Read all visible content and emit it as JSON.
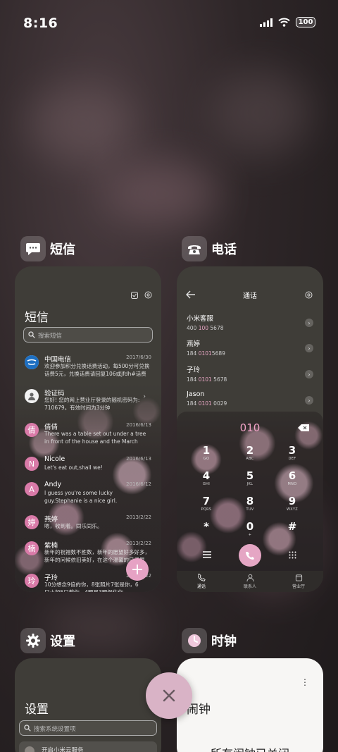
{
  "status": {
    "time": "8:16",
    "battery": "100"
  },
  "apps": {
    "sms": {
      "title": "短信",
      "inner_title": "短信",
      "search_placeholder": "搜索短信",
      "messages": [
        {
          "avatar": "",
          "name": "中国电信",
          "date": "2017/6/30",
          "preview": "欢迎参加积分兑换话费活动，每500分可兑换话费5元，兑换话费请回复106或jfdh#话费"
        },
        {
          "avatar": "",
          "name": "验证码",
          "date": "",
          "preview": "您好! 您的网上营业厅登录的随机密码为: 710679。有效时间为3分钟"
        },
        {
          "avatar": "倩",
          "name": "倩倩",
          "date": "2016/6/13",
          "preview": "There was a table set out under a tree in front of the house and the March Hare an..."
        },
        {
          "avatar": "N",
          "name": "Nicole",
          "date": "2016/6/13",
          "preview": "Let's eat out,shall we!"
        },
        {
          "avatar": "A",
          "name": "Andy",
          "date": "2016/6/12",
          "preview": "I guess you're some lucky guy.Stephanie is a nice girl."
        },
        {
          "avatar": "婷",
          "name": "燕婷",
          "date": "2013/2/22",
          "preview": "嗯，收到着。同乐同乐。"
        },
        {
          "avatar": "楠",
          "name": "紫楠",
          "date": "2013/2/22",
          "preview": "新年的祝福数不胜数，新年的愿望好多好多，新年的问候依旧美好，在这个温馨的日子里"
        },
        {
          "avatar": "玲",
          "name": "子玲",
          "date": "2013/2/22",
          "preview": "10分想念9倍的你，8张照片7张是你，6只小船5只载你，4颗星3颗保佑你"
        }
      ]
    },
    "phone": {
      "title": "电话",
      "inner_title": "通话",
      "contacts": [
        {
          "name": "小米客服",
          "num_pre": "400 ",
          "num_hl": "100",
          "num_post": " 5678"
        },
        {
          "name": "燕婷",
          "num_pre": "184 ",
          "num_hl": "0101",
          "num_post": "5689"
        },
        {
          "name": "子玲",
          "num_pre": "184 ",
          "num_hl": "0101",
          "num_post": " 5678"
        },
        {
          "name": "Jason",
          "num_pre": "184 ",
          "num_hl": "0101",
          "num_post": " 0029"
        }
      ],
      "dial_input": "010",
      "keys": [
        {
          "d": "1",
          "l": "GO"
        },
        {
          "d": "2",
          "l": "ABC"
        },
        {
          "d": "3",
          "l": "DEF"
        },
        {
          "d": "4",
          "l": "GHI"
        },
        {
          "d": "5",
          "l": "JKL"
        },
        {
          "d": "6",
          "l": "MNO"
        },
        {
          "d": "7",
          "l": "PQRS"
        },
        {
          "d": "8",
          "l": "TUV"
        },
        {
          "d": "9",
          "l": "WXYZ"
        },
        {
          "d": "*",
          "l": ""
        },
        {
          "d": "0",
          "l": "+"
        },
        {
          "d": "#",
          "l": ""
        }
      ],
      "tabs": [
        "通话",
        "联系人",
        "营业厅"
      ]
    },
    "settings": {
      "title": "设置",
      "inner_title": "设置",
      "search_placeholder": "搜索系统设置项",
      "first_item": "开启小米云服务"
    },
    "clock": {
      "title": "时钟",
      "inner_title": "闹钟",
      "empty_text": "所有闹钟已关闭"
    }
  },
  "colors": {
    "accent": "#d97aa8",
    "close_button": "#d9b3c6"
  }
}
